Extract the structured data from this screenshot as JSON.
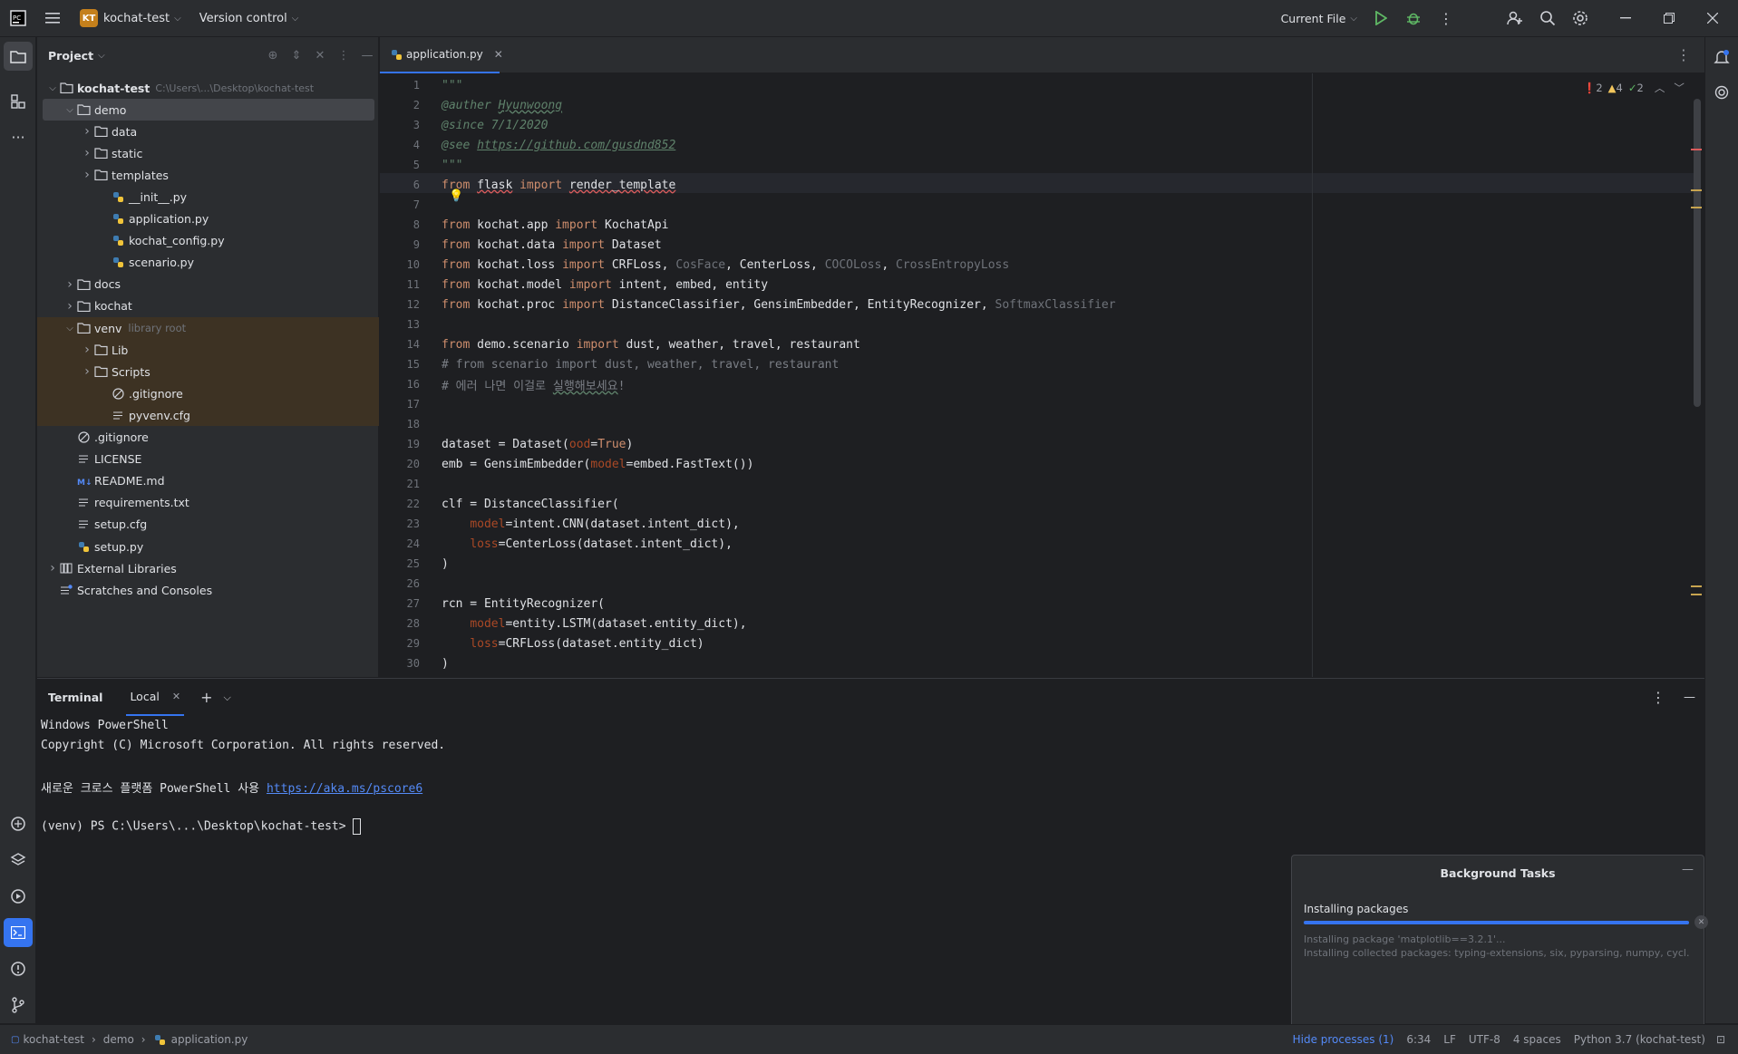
{
  "titlebar": {
    "project_badge": "KT",
    "project_name": "kochat-test",
    "vcs": "Version control",
    "run_config": "Current File"
  },
  "project_panel": {
    "title": "Project",
    "root_name": "kochat-test",
    "root_path": "C:\\Users\\...\\Desktop\\kochat-test",
    "items": [
      {
        "label": "demo",
        "type": "folder"
      },
      {
        "label": "data",
        "type": "folder"
      },
      {
        "label": "static",
        "type": "folder"
      },
      {
        "label": "templates",
        "type": "folder"
      },
      {
        "label": "__init__.py",
        "type": "py"
      },
      {
        "label": "application.py",
        "type": "py"
      },
      {
        "label": "kochat_config.py",
        "type": "py"
      },
      {
        "label": "scenario.py",
        "type": "py"
      },
      {
        "label": "docs",
        "type": "folder"
      },
      {
        "label": "kochat",
        "type": "folder"
      },
      {
        "label": "venv",
        "type": "folder",
        "suffix": "library root"
      },
      {
        "label": "Lib",
        "type": "folder"
      },
      {
        "label": "Scripts",
        "type": "folder"
      },
      {
        "label": ".gitignore",
        "type": "ignore"
      },
      {
        "label": "pyvenv.cfg",
        "type": "text"
      },
      {
        "label": ".gitignore",
        "type": "ignore"
      },
      {
        "label": "LICENSE",
        "type": "text"
      },
      {
        "label": "README.md",
        "type": "md"
      },
      {
        "label": "requirements.txt",
        "type": "text"
      },
      {
        "label": "setup.cfg",
        "type": "text"
      },
      {
        "label": "setup.py",
        "type": "py"
      },
      {
        "label": "External Libraries",
        "type": "lib"
      },
      {
        "label": "Scratches and Consoles",
        "type": "scratch"
      }
    ]
  },
  "editor": {
    "tab_label": "application.py",
    "inspections": {
      "errors": "2",
      "warnings": "4",
      "ok": "2"
    },
    "line_numbers": [
      "1",
      "2",
      "3",
      "4",
      "5",
      "6",
      "7",
      "8",
      "9",
      "10",
      "11",
      "12",
      "13",
      "14",
      "15",
      "16",
      "17",
      "18",
      "19",
      "20",
      "21",
      "22",
      "23",
      "24",
      "25",
      "26",
      "27",
      "28",
      "29",
      "30"
    ]
  },
  "terminal": {
    "title": "Terminal",
    "tab": "Local",
    "lines": [
      "Windows PowerShell",
      "Copyright (C) Microsoft Corporation. All rights reserved.",
      "",
      "새로운 크로스 플랫폼 PowerShell 사용 ",
      "",
      "(venv) PS C:\\Users\\...\\Desktop\\kochat-test> "
    ],
    "link": "https://aka.ms/pscore6"
  },
  "background_tasks": {
    "title": "Background Tasks",
    "task": "Installing packages",
    "progress": 1.0,
    "detail1": "Installing package 'matplotlib==3.2.1'...",
    "detail2": "Installing collected packages: typing-extensions, six, pyparsing, numpy, cycl..."
  },
  "statusbar": {
    "crumb_project": "kochat-test",
    "crumb_folder": "demo",
    "crumb_file": "application.py",
    "hide_processes": "Hide processes (1)",
    "position": "6:34",
    "line_sep": "LF",
    "encoding": "UTF-8",
    "indent": "4 spaces",
    "interpreter": "Python 3.7 (kochat-test)"
  },
  "colors": {
    "accent": "#3574f0",
    "panel": "#2b2d30",
    "editor_bg": "#1e1f22",
    "venv_highlight": "#3d3223"
  }
}
